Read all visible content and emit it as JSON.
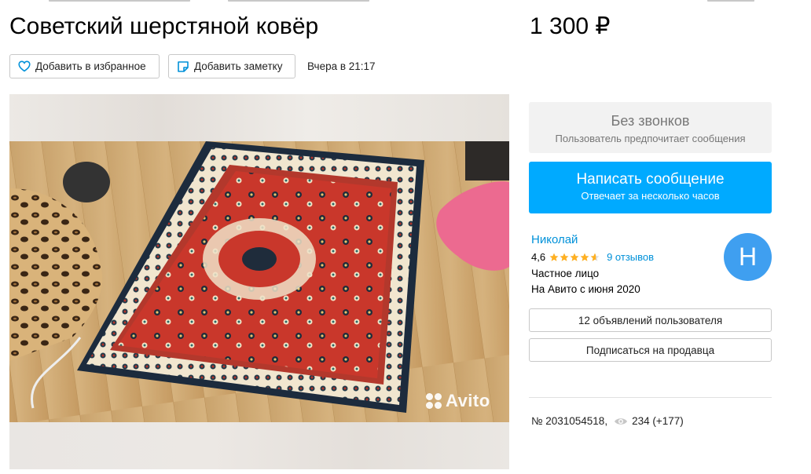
{
  "listing": {
    "title": "Советский шерстяной ковёр",
    "price": "1 300 ₽",
    "posted": "Вчера в 21:17",
    "number": "№ 2031054518,",
    "views": "234 (+177)"
  },
  "actions": {
    "favorite_label": "Добавить в избранное",
    "note_label": "Добавить заметку"
  },
  "photo": {
    "watermark": "Avito"
  },
  "contact": {
    "no_calls_title": "Без звонков",
    "no_calls_subtitle": "Пользователь предпочитает сообщения",
    "write_title": "Написать сообщение",
    "write_subtitle": "Отвечает за несколько часов"
  },
  "seller": {
    "name": "Николай",
    "rating": "4,6",
    "rating_value": 4.6,
    "rating_max": 5,
    "reviews": "9 отзывов",
    "type": "Частное лицо",
    "since": "На Авито с июня 2020",
    "avatar_letter": "Н",
    "listings_label": "12 объявлений пользователя",
    "subscribe_label": "Подписаться на продавца"
  },
  "colors": {
    "accent": "#00aaff",
    "link": "#0091d9",
    "star": "#ffb021",
    "avatar": "#3f9ff0"
  },
  "icons": {
    "favorite": "heart-icon",
    "note": "note-icon",
    "views": "eye-icon",
    "star": "star-icon"
  }
}
